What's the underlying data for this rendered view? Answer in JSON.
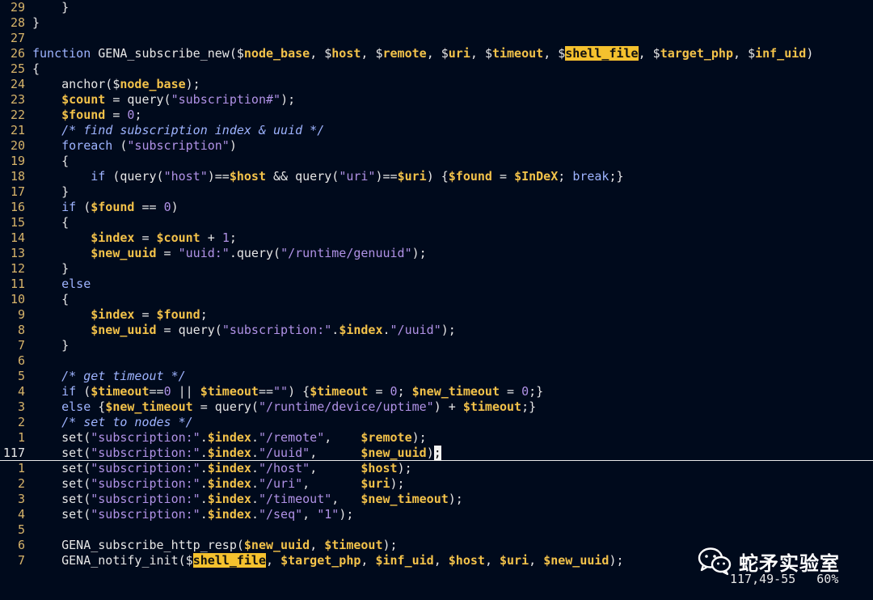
{
  "editor": {
    "lines": [
      {
        "num": "29",
        "tokens": [
          [
            "p",
            "    }"
          ]
        ]
      },
      {
        "num": "28",
        "tokens": [
          [
            "p",
            "}"
          ]
        ]
      },
      {
        "num": "27",
        "tokens": []
      },
      {
        "num": "26",
        "tokens": [
          [
            "kw",
            "function"
          ],
          [
            "p",
            " GENA_subscribe_new("
          ],
          [
            "p",
            "$"
          ],
          [
            "v",
            "node_base"
          ],
          [
            "p",
            ", "
          ],
          [
            "p",
            "$"
          ],
          [
            "v",
            "host"
          ],
          [
            "p",
            ", "
          ],
          [
            "p",
            "$"
          ],
          [
            "v",
            "remote"
          ],
          [
            "p",
            ", "
          ],
          [
            "p",
            "$"
          ],
          [
            "v",
            "uri"
          ],
          [
            "p",
            ", "
          ],
          [
            "p",
            "$"
          ],
          [
            "v",
            "timeout"
          ],
          [
            "p",
            ", "
          ],
          [
            "p",
            "$"
          ],
          [
            "h",
            "shell_file"
          ],
          [
            "p",
            ", "
          ],
          [
            "p",
            "$"
          ],
          [
            "v",
            "target_php"
          ],
          [
            "p",
            ", "
          ],
          [
            "p",
            "$"
          ],
          [
            "v",
            "inf_uid"
          ],
          [
            "p",
            ")"
          ]
        ]
      },
      {
        "num": "25",
        "tokens": [
          [
            "p",
            "{"
          ]
        ]
      },
      {
        "num": "24",
        "tokens": [
          [
            "p",
            "    anchor("
          ],
          [
            "p",
            "$"
          ],
          [
            "v",
            "node_base"
          ],
          [
            "p",
            ");"
          ]
        ]
      },
      {
        "num": "23",
        "tokens": [
          [
            "p",
            "    "
          ],
          [
            "v",
            "$count"
          ],
          [
            "p",
            " = query("
          ],
          [
            "s",
            "\"subscription#\""
          ],
          [
            "p",
            ");"
          ]
        ]
      },
      {
        "num": "22",
        "tokens": [
          [
            "p",
            "    "
          ],
          [
            "v",
            "$found"
          ],
          [
            "p",
            " = "
          ],
          [
            "n",
            "0"
          ],
          [
            "p",
            ";"
          ]
        ]
      },
      {
        "num": "21",
        "tokens": [
          [
            "p",
            "    "
          ],
          [
            "c",
            "/* find subscription index & uuid */"
          ]
        ]
      },
      {
        "num": "20",
        "tokens": [
          [
            "p",
            "    "
          ],
          [
            "kw",
            "foreach"
          ],
          [
            "p",
            " ("
          ],
          [
            "s",
            "\"subscription\""
          ],
          [
            "p",
            ")"
          ]
        ]
      },
      {
        "num": "19",
        "tokens": [
          [
            "p",
            "    {"
          ]
        ]
      },
      {
        "num": "18",
        "tokens": [
          [
            "p",
            "        "
          ],
          [
            "kw",
            "if"
          ],
          [
            "p",
            " (query("
          ],
          [
            "s",
            "\"host\""
          ],
          [
            "p",
            ")=="
          ],
          [
            "v",
            "$host"
          ],
          [
            "p",
            " && query("
          ],
          [
            "s",
            "\"uri\""
          ],
          [
            "p",
            ")=="
          ],
          [
            "v",
            "$uri"
          ],
          [
            "p",
            ") {"
          ],
          [
            "v",
            "$found"
          ],
          [
            "p",
            " = "
          ],
          [
            "v",
            "$InDeX"
          ],
          [
            "p",
            "; "
          ],
          [
            "kw",
            "break"
          ],
          [
            "p",
            ";}"
          ]
        ]
      },
      {
        "num": "17",
        "tokens": [
          [
            "p",
            "    }"
          ]
        ]
      },
      {
        "num": "16",
        "tokens": [
          [
            "p",
            "    "
          ],
          [
            "kw",
            "if"
          ],
          [
            "p",
            " ("
          ],
          [
            "v",
            "$found"
          ],
          [
            "p",
            " == "
          ],
          [
            "n",
            "0"
          ],
          [
            "p",
            ")"
          ]
        ]
      },
      {
        "num": "15",
        "tokens": [
          [
            "p",
            "    {"
          ]
        ]
      },
      {
        "num": "14",
        "tokens": [
          [
            "p",
            "        "
          ],
          [
            "v",
            "$index"
          ],
          [
            "p",
            " = "
          ],
          [
            "v",
            "$count"
          ],
          [
            "p",
            " + "
          ],
          [
            "n",
            "1"
          ],
          [
            "p",
            ";"
          ]
        ]
      },
      {
        "num": "13",
        "tokens": [
          [
            "p",
            "        "
          ],
          [
            "v",
            "$new_uuid"
          ],
          [
            "p",
            " = "
          ],
          [
            "s",
            "\"uuid:\""
          ],
          [
            "p",
            ".query("
          ],
          [
            "s",
            "\"/runtime/genuuid\""
          ],
          [
            "p",
            ");"
          ]
        ]
      },
      {
        "num": "12",
        "tokens": [
          [
            "p",
            "    }"
          ]
        ]
      },
      {
        "num": "11",
        "tokens": [
          [
            "p",
            "    "
          ],
          [
            "kw",
            "else"
          ]
        ]
      },
      {
        "num": "10",
        "tokens": [
          [
            "p",
            "    {"
          ]
        ]
      },
      {
        "num": "9",
        "tokens": [
          [
            "p",
            "        "
          ],
          [
            "v",
            "$index"
          ],
          [
            "p",
            " = "
          ],
          [
            "v",
            "$found"
          ],
          [
            "p",
            ";"
          ]
        ]
      },
      {
        "num": "8",
        "tokens": [
          [
            "p",
            "        "
          ],
          [
            "v",
            "$new_uuid"
          ],
          [
            "p",
            " = query("
          ],
          [
            "s",
            "\"subscription:\""
          ],
          [
            "p",
            "."
          ],
          [
            "v",
            "$index"
          ],
          [
            "p",
            "."
          ],
          [
            "s",
            "\"/uuid\""
          ],
          [
            "p",
            ");"
          ]
        ]
      },
      {
        "num": "7",
        "tokens": [
          [
            "p",
            "    }"
          ]
        ]
      },
      {
        "num": "6",
        "tokens": []
      },
      {
        "num": "5",
        "tokens": [
          [
            "p",
            "    "
          ],
          [
            "c",
            "/* get timeout */"
          ]
        ]
      },
      {
        "num": "4",
        "tokens": [
          [
            "p",
            "    "
          ],
          [
            "kw",
            "if"
          ],
          [
            "p",
            " ("
          ],
          [
            "v",
            "$timeout"
          ],
          [
            "p",
            "=="
          ],
          [
            "n",
            "0"
          ],
          [
            "p",
            " || "
          ],
          [
            "v",
            "$timeout"
          ],
          [
            "p",
            "=="
          ],
          [
            "s",
            "\"\""
          ],
          [
            "p",
            ") {"
          ],
          [
            "v",
            "$timeout"
          ],
          [
            "p",
            " = "
          ],
          [
            "n",
            "0"
          ],
          [
            "p",
            "; "
          ],
          [
            "v",
            "$new_timeout"
          ],
          [
            "p",
            " = "
          ],
          [
            "n",
            "0"
          ],
          [
            "p",
            ";}"
          ]
        ]
      },
      {
        "num": "3",
        "tokens": [
          [
            "p",
            "    "
          ],
          [
            "kw",
            "else"
          ],
          [
            "p",
            " {"
          ],
          [
            "v",
            "$new_timeout"
          ],
          [
            "p",
            " = query("
          ],
          [
            "s",
            "\"/runtime/device/uptime\""
          ],
          [
            "p",
            ") + "
          ],
          [
            "v",
            "$timeout"
          ],
          [
            "p",
            ";}"
          ]
        ]
      },
      {
        "num": "2",
        "tokens": [
          [
            "p",
            "    "
          ],
          [
            "c",
            "/* set to nodes */"
          ]
        ]
      },
      {
        "num": "1",
        "tokens": [
          [
            "p",
            "    set("
          ],
          [
            "s",
            "\"subscription:\""
          ],
          [
            "p",
            "."
          ],
          [
            "v",
            "$index"
          ],
          [
            "p",
            "."
          ],
          [
            "s",
            "\"/remote\""
          ],
          [
            "p",
            ",    "
          ],
          [
            "v",
            "$remote"
          ],
          [
            "p",
            ");"
          ]
        ]
      },
      {
        "num": "117",
        "current": true,
        "tokens": [
          [
            "p",
            "    set("
          ],
          [
            "s",
            "\"subscription:\""
          ],
          [
            "p",
            "."
          ],
          [
            "v",
            "$index"
          ],
          [
            "p",
            "."
          ],
          [
            "s",
            "\"/uuid\""
          ],
          [
            "p",
            ",      "
          ],
          [
            "v",
            "$new_uuid"
          ],
          [
            "p",
            ")"
          ],
          [
            "cur",
            ";"
          ]
        ]
      },
      {
        "num": "1",
        "tokens": [
          [
            "p",
            "    set("
          ],
          [
            "s",
            "\"subscription:\""
          ],
          [
            "p",
            "."
          ],
          [
            "v",
            "$index"
          ],
          [
            "p",
            "."
          ],
          [
            "s",
            "\"/host\""
          ],
          [
            "p",
            ",      "
          ],
          [
            "v",
            "$host"
          ],
          [
            "p",
            ");"
          ]
        ]
      },
      {
        "num": "2",
        "tokens": [
          [
            "p",
            "    set("
          ],
          [
            "s",
            "\"subscription:\""
          ],
          [
            "p",
            "."
          ],
          [
            "v",
            "$index"
          ],
          [
            "p",
            "."
          ],
          [
            "s",
            "\"/uri\""
          ],
          [
            "p",
            ",       "
          ],
          [
            "v",
            "$uri"
          ],
          [
            "p",
            ");"
          ]
        ]
      },
      {
        "num": "3",
        "tokens": [
          [
            "p",
            "    set("
          ],
          [
            "s",
            "\"subscription:\""
          ],
          [
            "p",
            "."
          ],
          [
            "v",
            "$index"
          ],
          [
            "p",
            "."
          ],
          [
            "s",
            "\"/timeout\""
          ],
          [
            "p",
            ",   "
          ],
          [
            "v",
            "$new_timeout"
          ],
          [
            "p",
            ");"
          ]
        ]
      },
      {
        "num": "4",
        "tokens": [
          [
            "p",
            "    set("
          ],
          [
            "s",
            "\"subscription:\""
          ],
          [
            "p",
            "."
          ],
          [
            "v",
            "$index"
          ],
          [
            "p",
            "."
          ],
          [
            "s",
            "\"/seq\""
          ],
          [
            "p",
            ", "
          ],
          [
            "s",
            "\"1\""
          ],
          [
            "p",
            ");"
          ]
        ]
      },
      {
        "num": "5",
        "tokens": []
      },
      {
        "num": "6",
        "tokens": [
          [
            "p",
            "    GENA_subscribe_http_resp("
          ],
          [
            "v",
            "$new_uuid"
          ],
          [
            "p",
            ", "
          ],
          [
            "v",
            "$timeout"
          ],
          [
            "p",
            ");"
          ]
        ]
      },
      {
        "num": "7",
        "tokens": [
          [
            "p",
            "    GENA_notify_init("
          ],
          [
            "p",
            "$"
          ],
          [
            "h",
            "shell_file"
          ],
          [
            "p",
            ", "
          ],
          [
            "v",
            "$target_php"
          ],
          [
            "p",
            ", "
          ],
          [
            "v",
            "$inf_uid"
          ],
          [
            "p",
            ", "
          ],
          [
            "v",
            "$host"
          ],
          [
            "p",
            ", "
          ],
          [
            "v",
            "$uri"
          ],
          [
            "p",
            ", "
          ],
          [
            "v",
            "$new_uuid"
          ],
          [
            "p",
            ");"
          ]
        ]
      }
    ]
  },
  "status": {
    "position": "117,49-55",
    "percent": "60%"
  },
  "watermark": {
    "text": "蛇矛实验室",
    "icon": "wechat-icon"
  },
  "colors": {
    "background": "#000a1c",
    "keyword": "#9eb4ff",
    "variable": "#f3c24a",
    "string": "#b092e6",
    "line_number": "#d7b46a",
    "search_highlight": "#f5c12e"
  }
}
